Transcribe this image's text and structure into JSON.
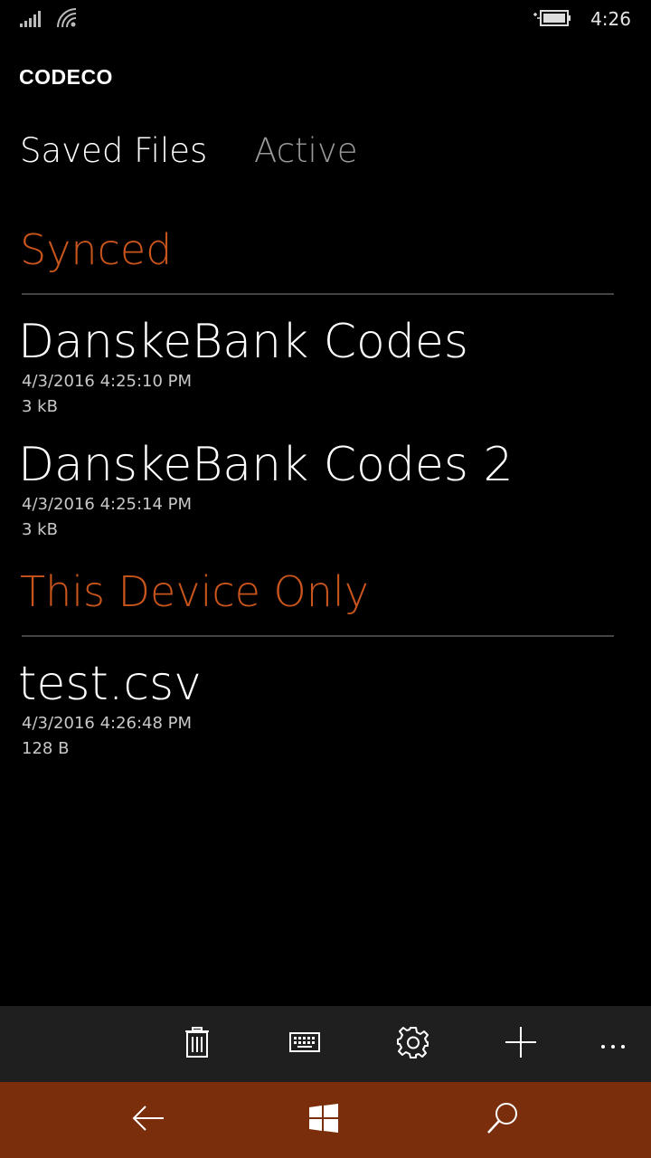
{
  "status_bar": {
    "time": "4:26"
  },
  "app": {
    "title": "CODECO"
  },
  "pivot": {
    "tabs": [
      {
        "label": "Saved Files",
        "active": true
      },
      {
        "label": "Active",
        "active": false
      }
    ]
  },
  "groups": [
    {
      "header": "Synced",
      "files": [
        {
          "name": "DanskeBank Codes",
          "date": "4/3/2016 4:25:10 PM",
          "size": "3 kB"
        },
        {
          "name": "DanskeBank Codes 2",
          "date": "4/3/2016 4:25:14 PM",
          "size": "3 kB"
        }
      ]
    },
    {
      "header": "This Device Only",
      "files": [
        {
          "name": "test.csv",
          "date": "4/3/2016 4:26:48 PM",
          "size": "128 B"
        }
      ]
    }
  ],
  "app_bar": {
    "buttons": [
      "trash-icon",
      "keyboard-icon",
      "gear-icon",
      "plus-icon",
      "more-icon"
    ]
  },
  "nav_bar": {
    "buttons": [
      "back-arrow-icon",
      "windows-start-icon",
      "search-icon"
    ]
  },
  "colors": {
    "accent": "#c9551c",
    "nav_bar_background": "#7a2e0c",
    "app_bar_background": "#1f1f1f",
    "background": "#000000"
  }
}
